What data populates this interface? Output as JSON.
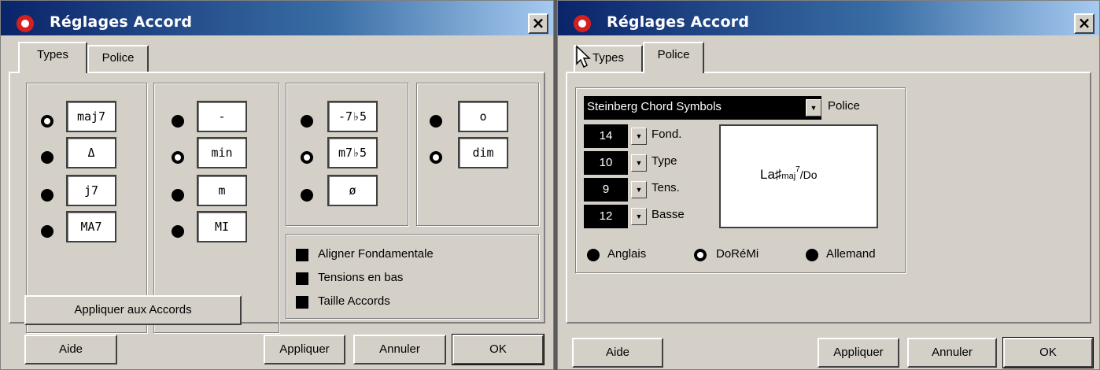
{
  "left": {
    "title": "Réglages Accord",
    "tabs": [
      "Types",
      "Police"
    ],
    "maj_group": [
      "maj7",
      "Δ",
      "j7",
      "MA7"
    ],
    "min_group": [
      "-",
      "min",
      "m",
      "MI"
    ],
    "halfdim_group": [
      "-7♭5",
      "m7♭5",
      "ø"
    ],
    "dim_group": [
      "o",
      "dim"
    ],
    "checkboxes": [
      "Aligner Fondamentale",
      "Tensions en bas",
      "Taille Accords"
    ],
    "apply_chords": "Appliquer aux Accords",
    "buttons": {
      "help": "Aide",
      "apply": "Appliquer",
      "cancel": "Annuler",
      "ok": "OK"
    }
  },
  "right": {
    "title": "Réglages Accord",
    "tabs": [
      "Types",
      "Police"
    ],
    "font_select": "Steinberg Chord Symbols",
    "font_label": "Police",
    "sizes": [
      {
        "value": "14",
        "label": "Fond."
      },
      {
        "value": "10",
        "label": "Type"
      },
      {
        "value": "9",
        "label": "Tens."
      },
      {
        "value": "12",
        "label": "Basse"
      }
    ],
    "preview": {
      "root": "La♯",
      "type": "maj",
      "tension": "7",
      "bass": "/Do"
    },
    "notation": [
      "Anglais",
      "DoRéMi",
      "Allemand"
    ],
    "buttons": {
      "help": "Aide",
      "apply": "Appliquer",
      "cancel": "Annuler",
      "ok": "OK"
    }
  },
  "colors": {
    "titlebar_start": "#0a246a",
    "titlebar_end": "#a6caf0",
    "dialog_bg": "#d4d0c8",
    "icon_red": "#d42020"
  }
}
